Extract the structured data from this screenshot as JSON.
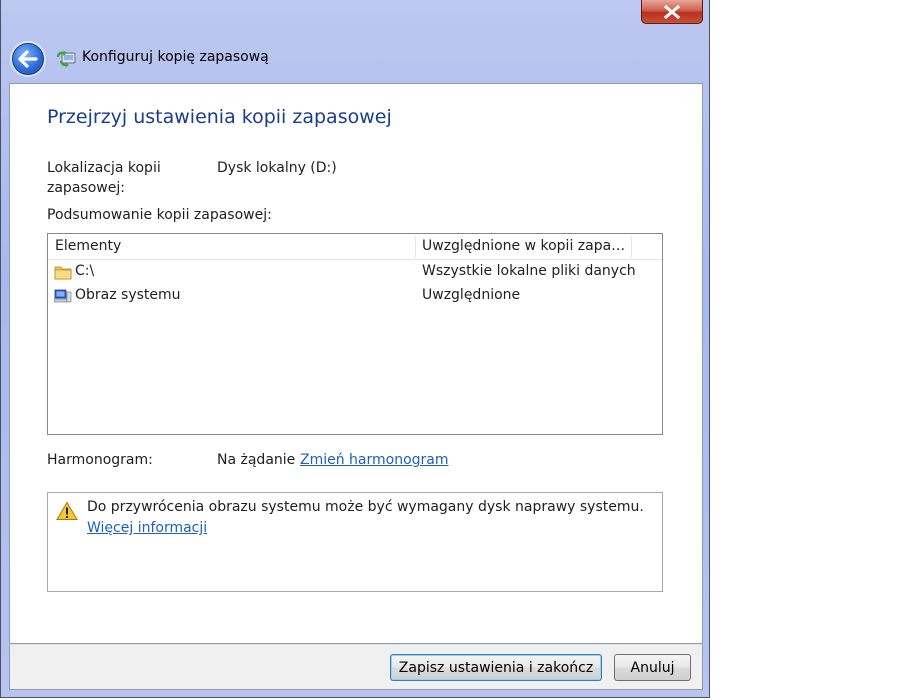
{
  "window": {
    "title": "Konfiguruj kopię zapasową"
  },
  "page": {
    "heading": "Przejrzyj ustawienia kopii zapasowej",
    "location_label_line1": "Lokalizacja kopii",
    "location_label_line2": "zapasowej:",
    "location_value": "Dysk lokalny (D:)",
    "summary_label": "Podsumowanie kopii zapasowej:"
  },
  "summary_list": {
    "columns": [
      "Elementy",
      "Uwzględnione w kopii zapasowej"
    ],
    "rows": [
      {
        "item": "C:\\",
        "included": "Wszystkie lokalne pliki danych",
        "icon": "folder-icon"
      },
      {
        "item": "Obraz systemu",
        "included": "Uwzględnione",
        "icon": "computer-icon"
      }
    ]
  },
  "schedule": {
    "label": "Harmonogram:",
    "value": "Na żądanie",
    "change_link": "Zmień harmonogram"
  },
  "warning": {
    "text": "Do przywrócenia obrazu systemu może być wymagany dysk naprawy systemu.",
    "link": "Więcej informacji",
    "icon": "warning-icon"
  },
  "buttons": {
    "save": "Zapisz ustawienia i zakończ",
    "cancel": "Anuluj"
  },
  "colors": {
    "heading": "#1a3c8c",
    "link": "#1c5fbf",
    "frame": "#a9b8ec"
  }
}
